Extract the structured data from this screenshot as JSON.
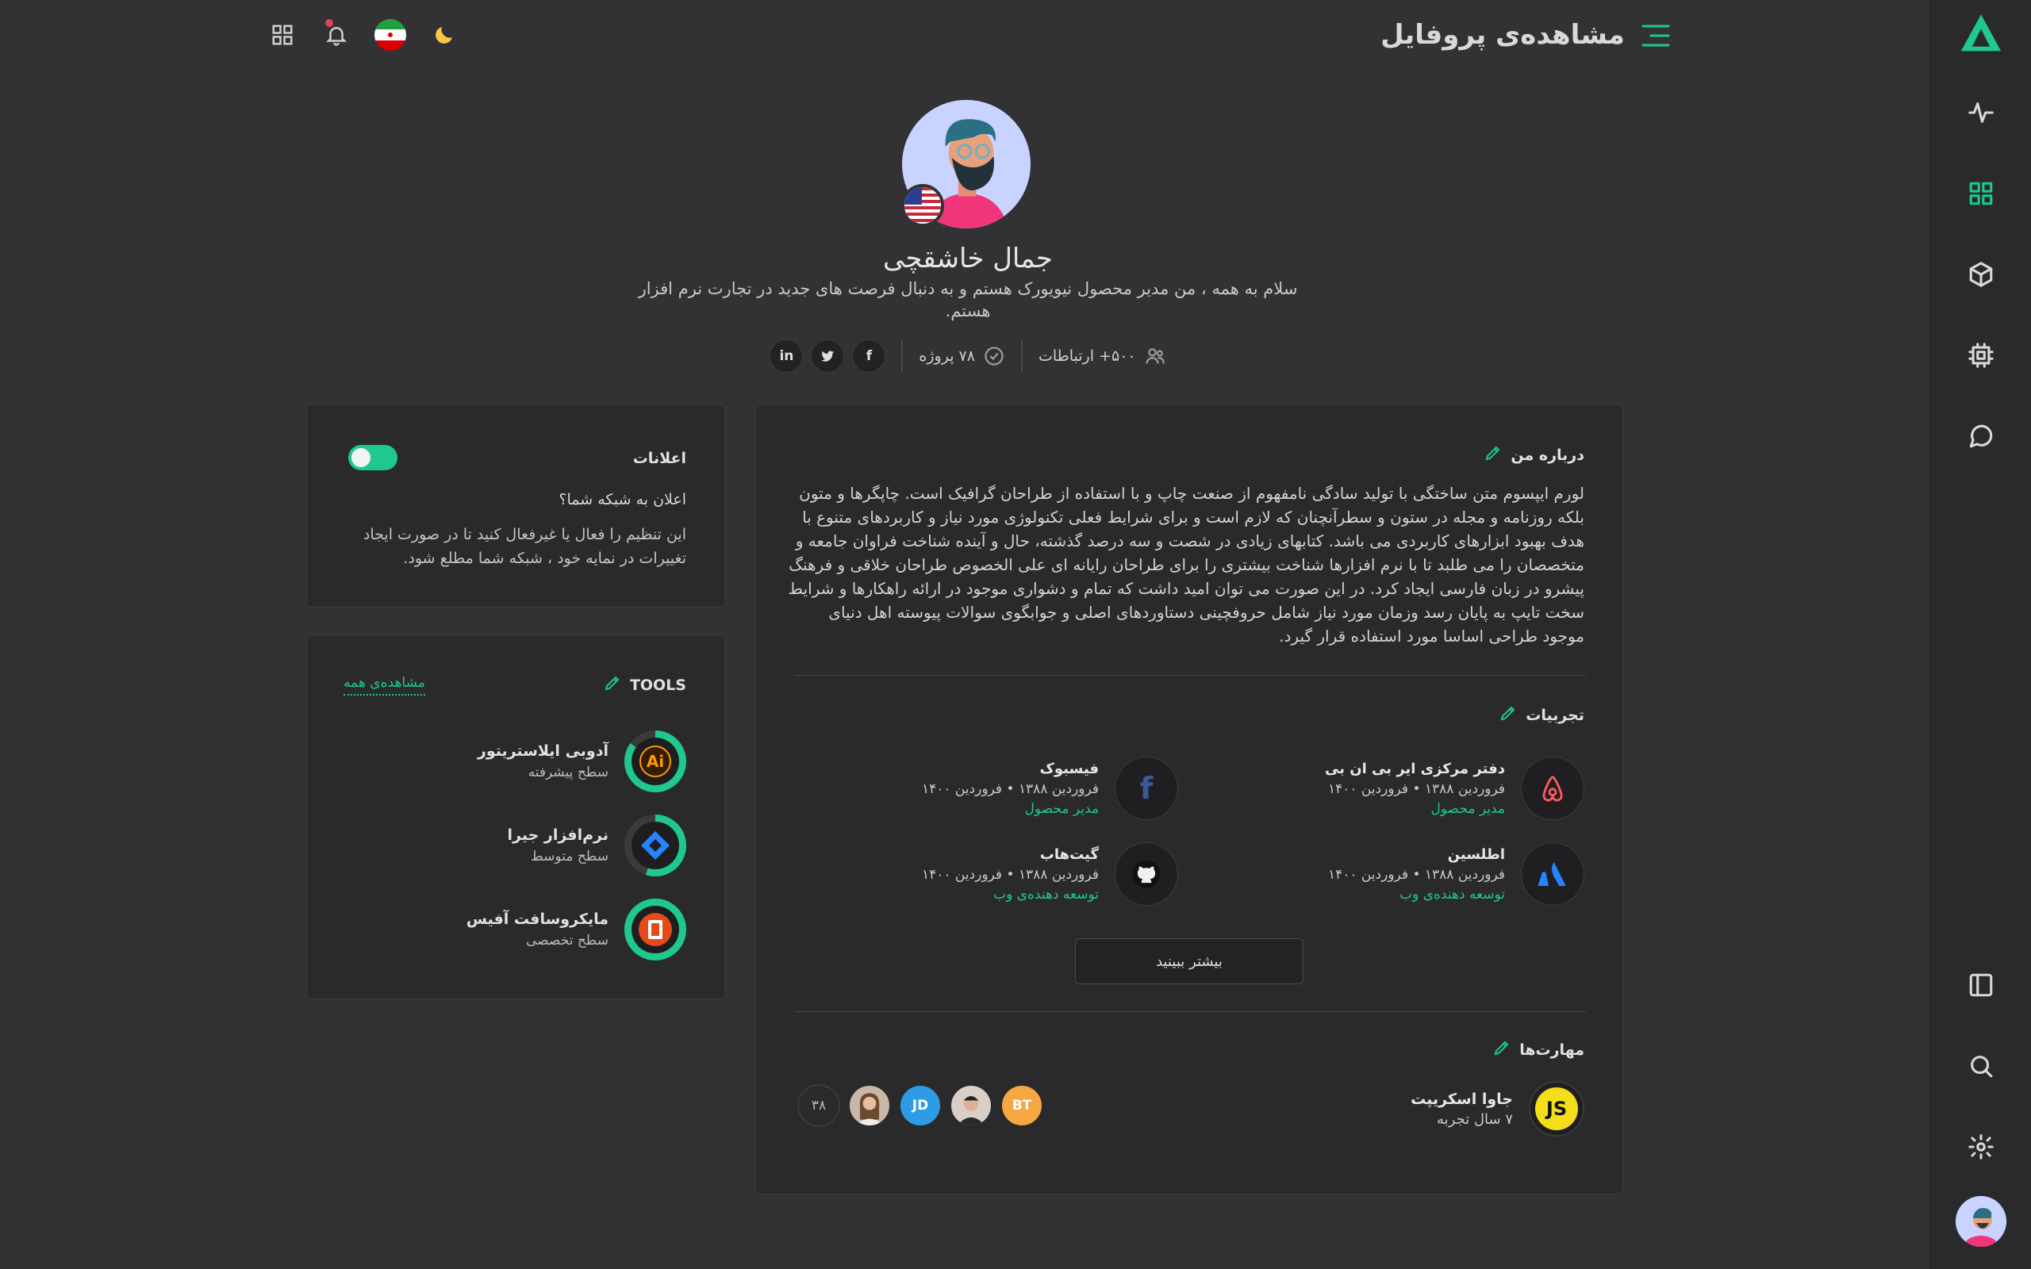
{
  "header": {
    "title": "مشاهده‌ی پروفایل"
  },
  "profile": {
    "name": "جمال خاشقچی",
    "bio": "سلام به همه ، من مدیر محصول نیویورک هستم و به دنبال فرصت های جدید در تجارت نرم افزار هستم.",
    "connections": "۵۰۰+ ارتباطات",
    "projects": "۷۸ پروژه",
    "social": [
      "facebook",
      "twitter",
      "linkedin"
    ]
  },
  "notifications": {
    "title": "اعلانات",
    "question": "اعلان به شبکه شما؟",
    "description": "این تنظیم را فعال یا غیرفعال کنید تا در صورت ایجاد تغییرات در نمایه خود ، شبکه شما مطلع شود.",
    "enabled": true
  },
  "tools": {
    "title": "TOOLS",
    "see_all": "مشاهده‌ی همه",
    "items": [
      {
        "name": "آدوبی ایلاستریتور",
        "level": "سطح پیشرفته",
        "icon": "illustrator-icon"
      },
      {
        "name": "نرم‌افزار جیرا",
        "level": "سطح متوسط",
        "icon": "jira-icon"
      },
      {
        "name": "مایکروسافت آفیس",
        "level": "سطح تخصصی",
        "icon": "office-icon"
      }
    ]
  },
  "about": {
    "title": "درباره من",
    "text": "لورم ایپسوم متن ساختگی با تولید سادگی نامفهوم از صنعت چاپ و با استفاده از طراحان گرافیک است. چاپگرها و متون بلکه روزنامه و مجله در ستون و سطرآنچنان که لازم است و برای شرایط فعلی تکنولوژی مورد نیاز و کاربردهای متنوع با هدف بهبود ابزارهای کاربردی می باشد. کتابهای زیادی در شصت و سه درصد گذشته، حال و آینده شناخت فراوان جامعه و متخصصان را می طلبد تا با نرم افزارها شناخت بیشتری را برای طراحان رایانه ای علی الخصوص طراحان خلاقی و فرهنگ پیشرو در زبان فارسی ایجاد کرد. در این صورت می توان امید داشت که تمام و دشواری موجود در ارائه راهکارها و شرایط سخت تایپ به پایان رسد وزمان مورد نیاز شامل حروفچینی دستاوردهای اصلی و جوابگوی سوالات پیوسته اهل دنیای موجود طراحی اساسا مورد استفاده قرار گیرد."
  },
  "experience": {
    "title": "تجربیات",
    "more": "بیشتر ببینید",
    "items": [
      {
        "company": "دفتر مرکزی ایر بی ان بی",
        "dates": "فروردین ۱۳۸۸ • فروردین ۱۴۰۰",
        "role": "مدیر محصول",
        "icon": "airbnb-icon"
      },
      {
        "company": "فیسبوک",
        "dates": "فروردین ۱۳۸۸ • فروردین ۱۴۰۰",
        "role": "مدیر محصول",
        "icon": "facebook-icon"
      },
      {
        "company": "اطلسین",
        "dates": "فروردین ۱۳۸۸ • فروردین ۱۴۰۰",
        "role": "توسعه دهنده‌ی وب",
        "icon": "atlassian-icon"
      },
      {
        "company": "گیت‌هاب",
        "dates": "فروردین ۱۳۸۸ • فروردین ۱۴۰۰",
        "role": "توسعه دهنده‌ی وب",
        "icon": "github-icon"
      }
    ]
  },
  "skills": {
    "title": "مهارت‌ها",
    "items": [
      {
        "name": "جاوا اسکریپت",
        "experience": "۷ سال تجربه",
        "badge": "JS"
      }
    ],
    "people": [
      {
        "initials": "BT",
        "color": "#f5a742"
      },
      {
        "initials": "",
        "color": "#d8d0c8"
      },
      {
        "initials": "JD",
        "color": "#2e9be6"
      },
      {
        "initials": "",
        "color": "#c9b8a8"
      },
      {
        "initials": "۳۸",
        "color": "#2a2a2c"
      }
    ]
  },
  "colors": {
    "accent": "#1fc98e",
    "background": "#323234",
    "card": "#2a2a2c"
  }
}
